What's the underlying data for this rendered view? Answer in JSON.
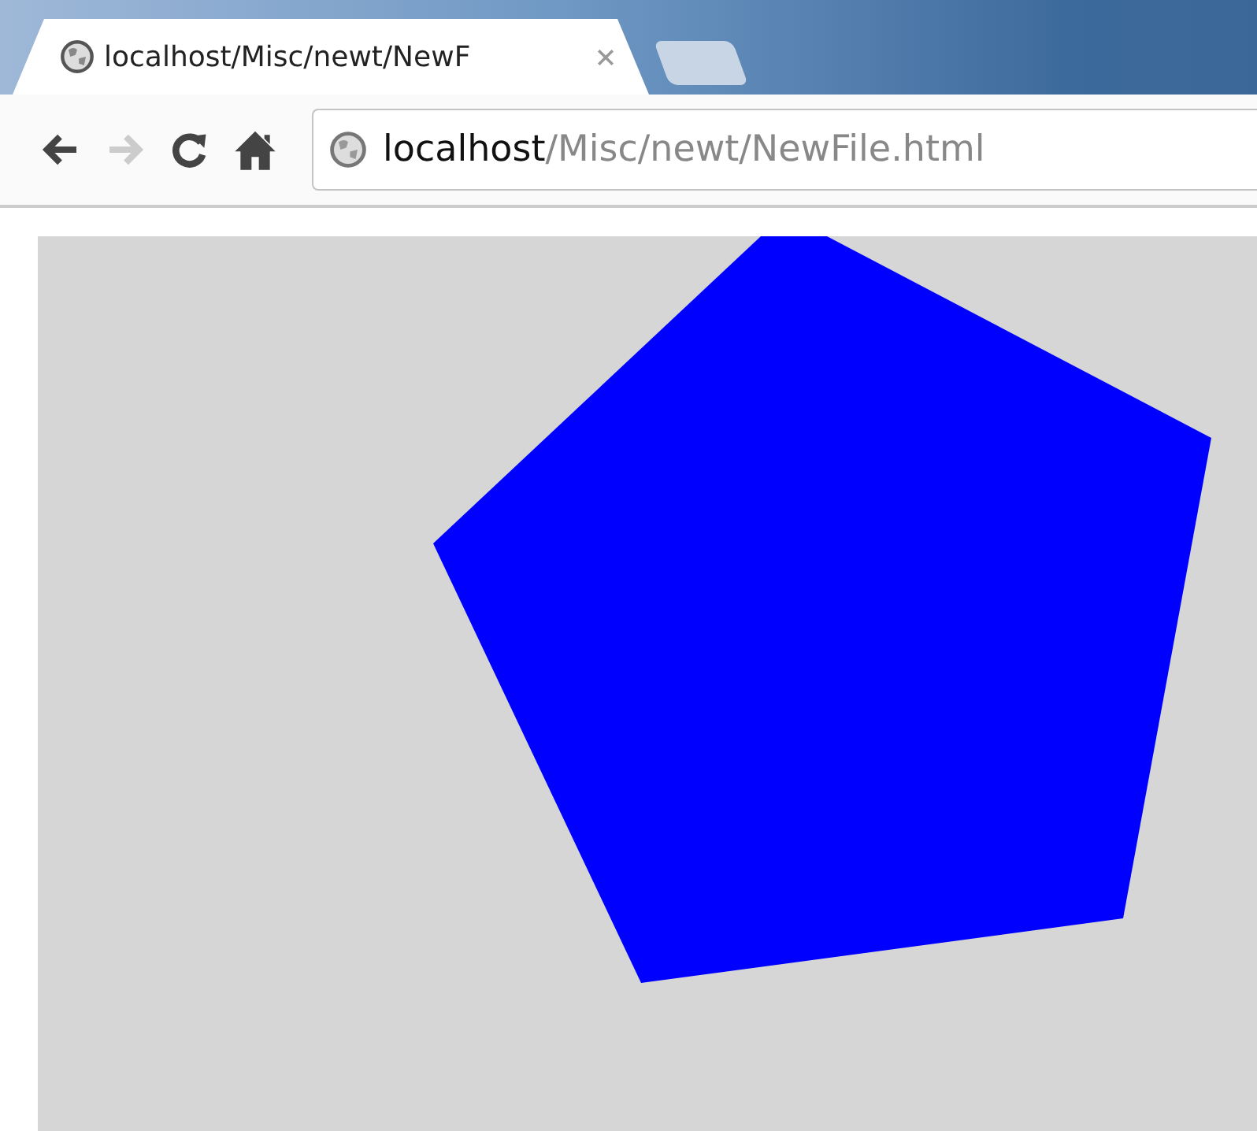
{
  "tabs": [
    {
      "title": "localhost/Misc/newt/NewF",
      "selected": true
    }
  ],
  "nav_buttons": [
    {
      "kind": "back",
      "disabled": false
    },
    {
      "kind": "forward",
      "disabled": true
    },
    {
      "kind": "reload",
      "disabled": false
    },
    {
      "kind": "home",
      "disabled": false
    }
  ],
  "address_bar": {
    "host": "localhost",
    "path": "/Misc/newt/NewFile.html"
  }
}
